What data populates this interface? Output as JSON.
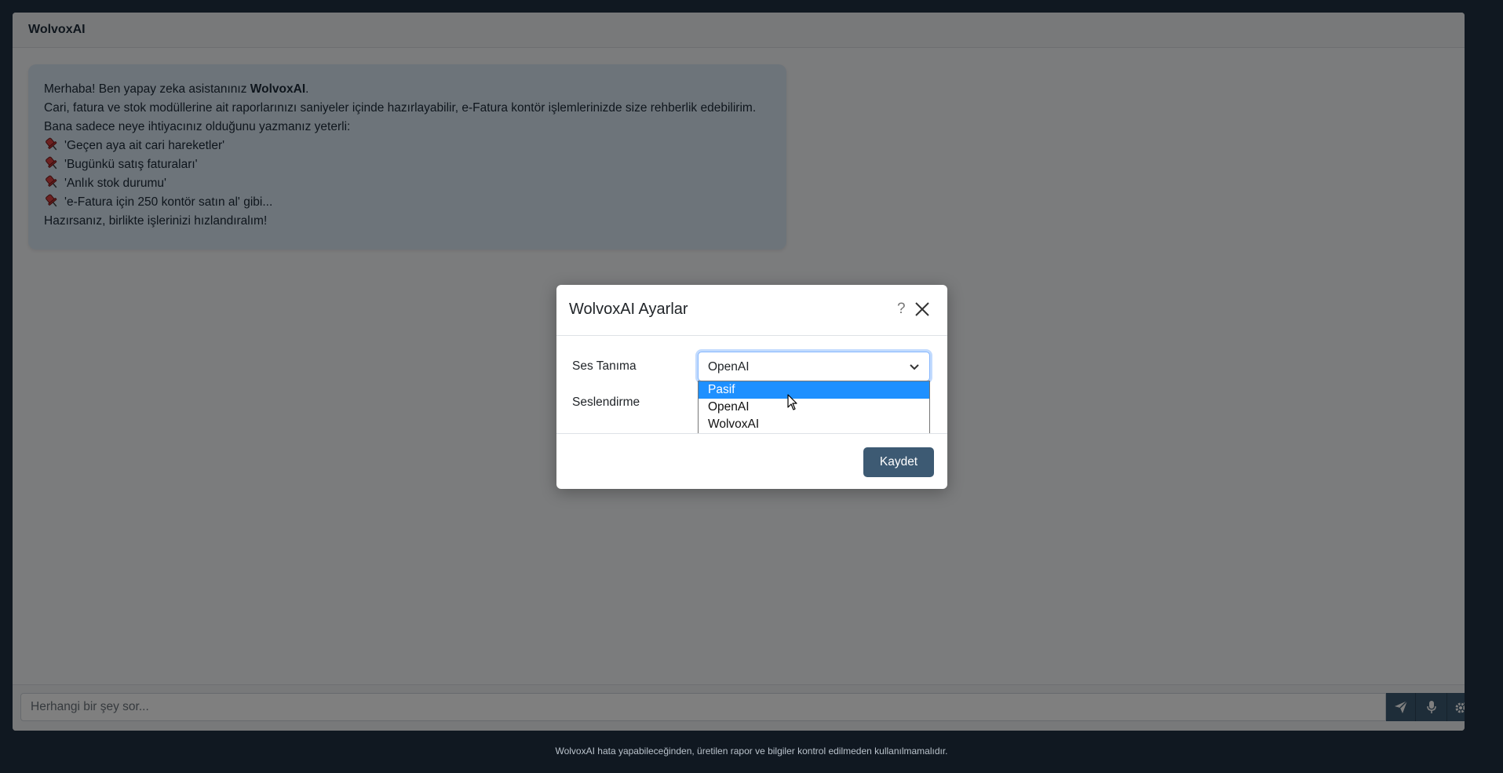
{
  "app": {
    "title": "WolvoxAI"
  },
  "welcome": {
    "greeting_prefix": "Merhaba! Ben yapay zeka asistanınız ",
    "brand": "WolvoxAI",
    "greeting_suffix": ".",
    "line2": "Cari, fatura ve stok modüllerine ait raporlarınızı saniyeler içinde hazırlayabilir, e-Fatura kontör işlemlerinizde size rehberlik edebilirim.",
    "line3": "Bana sadece neye ihtiyacınız olduğunu yazmanız yeterli:",
    "examples": [
      "'Geçen aya ait cari hareketler'",
      "'Bugünkü satış faturaları'",
      "'Anlık stok durumu'",
      "'e-Fatura için 250 kontör satın al' gibi..."
    ],
    "closing": "Hazırsanız, birlikte işlerinizi hızlandıralım!"
  },
  "chat": {
    "placeholder": "Herhangi bir şey sor..."
  },
  "footer": {
    "note": "WolvoxAI hata yapabileceğinden, üretilen rapor ve bilgiler kontrol edilmeden kullanılmamalıdır."
  },
  "modal": {
    "title": "WolvoxAI Ayarlar",
    "help": "?",
    "speech_recognition_label": "Ses Tanıma",
    "speech_recognition_value": "OpenAI",
    "voice_output_label": "Seslendirme",
    "options": [
      "Pasif",
      "OpenAI",
      "WolvoxAI"
    ],
    "highlighted_option": "Pasif",
    "save_label": "Kaydet"
  },
  "colors": {
    "accent": "#3d5a73",
    "bubble": "#dbe8f4",
    "highlight": "#1e90ff",
    "frame": "#203142"
  }
}
